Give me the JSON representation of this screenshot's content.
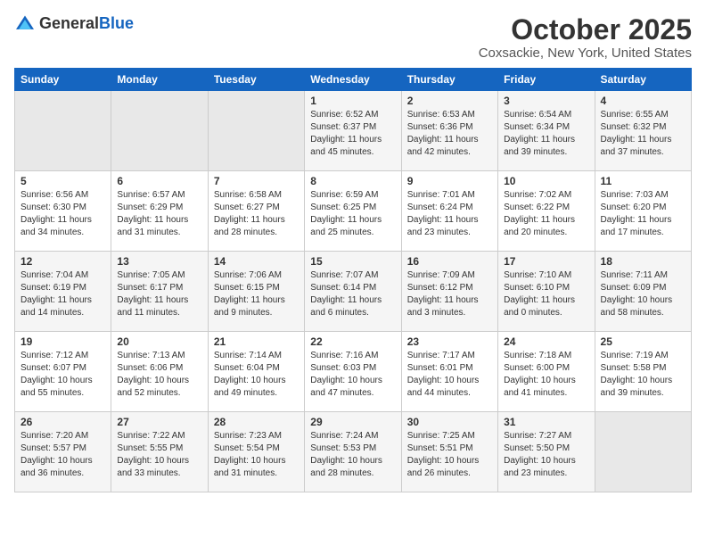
{
  "header": {
    "logo_general": "General",
    "logo_blue": "Blue",
    "month_title": "October 2025",
    "location": "Coxsackie, New York, United States"
  },
  "days_of_week": [
    "Sunday",
    "Monday",
    "Tuesday",
    "Wednesday",
    "Thursday",
    "Friday",
    "Saturday"
  ],
  "weeks": [
    [
      {
        "day": "",
        "info": ""
      },
      {
        "day": "",
        "info": ""
      },
      {
        "day": "",
        "info": ""
      },
      {
        "day": "1",
        "info": "Sunrise: 6:52 AM\nSunset: 6:37 PM\nDaylight: 11 hours\nand 45 minutes."
      },
      {
        "day": "2",
        "info": "Sunrise: 6:53 AM\nSunset: 6:36 PM\nDaylight: 11 hours\nand 42 minutes."
      },
      {
        "day": "3",
        "info": "Sunrise: 6:54 AM\nSunset: 6:34 PM\nDaylight: 11 hours\nand 39 minutes."
      },
      {
        "day": "4",
        "info": "Sunrise: 6:55 AM\nSunset: 6:32 PM\nDaylight: 11 hours\nand 37 minutes."
      }
    ],
    [
      {
        "day": "5",
        "info": "Sunrise: 6:56 AM\nSunset: 6:30 PM\nDaylight: 11 hours\nand 34 minutes."
      },
      {
        "day": "6",
        "info": "Sunrise: 6:57 AM\nSunset: 6:29 PM\nDaylight: 11 hours\nand 31 minutes."
      },
      {
        "day": "7",
        "info": "Sunrise: 6:58 AM\nSunset: 6:27 PM\nDaylight: 11 hours\nand 28 minutes."
      },
      {
        "day": "8",
        "info": "Sunrise: 6:59 AM\nSunset: 6:25 PM\nDaylight: 11 hours\nand 25 minutes."
      },
      {
        "day": "9",
        "info": "Sunrise: 7:01 AM\nSunset: 6:24 PM\nDaylight: 11 hours\nand 23 minutes."
      },
      {
        "day": "10",
        "info": "Sunrise: 7:02 AM\nSunset: 6:22 PM\nDaylight: 11 hours\nand 20 minutes."
      },
      {
        "day": "11",
        "info": "Sunrise: 7:03 AM\nSunset: 6:20 PM\nDaylight: 11 hours\nand 17 minutes."
      }
    ],
    [
      {
        "day": "12",
        "info": "Sunrise: 7:04 AM\nSunset: 6:19 PM\nDaylight: 11 hours\nand 14 minutes."
      },
      {
        "day": "13",
        "info": "Sunrise: 7:05 AM\nSunset: 6:17 PM\nDaylight: 11 hours\nand 11 minutes."
      },
      {
        "day": "14",
        "info": "Sunrise: 7:06 AM\nSunset: 6:15 PM\nDaylight: 11 hours\nand 9 minutes."
      },
      {
        "day": "15",
        "info": "Sunrise: 7:07 AM\nSunset: 6:14 PM\nDaylight: 11 hours\nand 6 minutes."
      },
      {
        "day": "16",
        "info": "Sunrise: 7:09 AM\nSunset: 6:12 PM\nDaylight: 11 hours\nand 3 minutes."
      },
      {
        "day": "17",
        "info": "Sunrise: 7:10 AM\nSunset: 6:10 PM\nDaylight: 11 hours\nand 0 minutes."
      },
      {
        "day": "18",
        "info": "Sunrise: 7:11 AM\nSunset: 6:09 PM\nDaylight: 10 hours\nand 58 minutes."
      }
    ],
    [
      {
        "day": "19",
        "info": "Sunrise: 7:12 AM\nSunset: 6:07 PM\nDaylight: 10 hours\nand 55 minutes."
      },
      {
        "day": "20",
        "info": "Sunrise: 7:13 AM\nSunset: 6:06 PM\nDaylight: 10 hours\nand 52 minutes."
      },
      {
        "day": "21",
        "info": "Sunrise: 7:14 AM\nSunset: 6:04 PM\nDaylight: 10 hours\nand 49 minutes."
      },
      {
        "day": "22",
        "info": "Sunrise: 7:16 AM\nSunset: 6:03 PM\nDaylight: 10 hours\nand 47 minutes."
      },
      {
        "day": "23",
        "info": "Sunrise: 7:17 AM\nSunset: 6:01 PM\nDaylight: 10 hours\nand 44 minutes."
      },
      {
        "day": "24",
        "info": "Sunrise: 7:18 AM\nSunset: 6:00 PM\nDaylight: 10 hours\nand 41 minutes."
      },
      {
        "day": "25",
        "info": "Sunrise: 7:19 AM\nSunset: 5:58 PM\nDaylight: 10 hours\nand 39 minutes."
      }
    ],
    [
      {
        "day": "26",
        "info": "Sunrise: 7:20 AM\nSunset: 5:57 PM\nDaylight: 10 hours\nand 36 minutes."
      },
      {
        "day": "27",
        "info": "Sunrise: 7:22 AM\nSunset: 5:55 PM\nDaylight: 10 hours\nand 33 minutes."
      },
      {
        "day": "28",
        "info": "Sunrise: 7:23 AM\nSunset: 5:54 PM\nDaylight: 10 hours\nand 31 minutes."
      },
      {
        "day": "29",
        "info": "Sunrise: 7:24 AM\nSunset: 5:53 PM\nDaylight: 10 hours\nand 28 minutes."
      },
      {
        "day": "30",
        "info": "Sunrise: 7:25 AM\nSunset: 5:51 PM\nDaylight: 10 hours\nand 26 minutes."
      },
      {
        "day": "31",
        "info": "Sunrise: 7:27 AM\nSunset: 5:50 PM\nDaylight: 10 hours\nand 23 minutes."
      },
      {
        "day": "",
        "info": ""
      }
    ]
  ]
}
